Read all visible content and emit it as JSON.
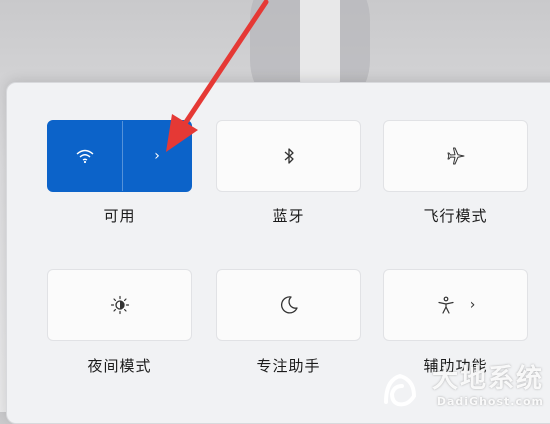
{
  "quick_settings": {
    "tiles": [
      {
        "id": "wifi",
        "label": "可用",
        "icon": "wifi-icon",
        "active": true,
        "has_chevron": true
      },
      {
        "id": "bluetooth",
        "label": "蓝牙",
        "icon": "bluetooth-icon",
        "active": false,
        "has_chevron": false
      },
      {
        "id": "airplane",
        "label": "飞行模式",
        "icon": "airplane-icon",
        "active": false,
        "has_chevron": false
      },
      {
        "id": "night-light",
        "label": "夜间模式",
        "icon": "night-light-icon",
        "active": false,
        "has_chevron": false
      },
      {
        "id": "focus-assist",
        "label": "专注助手",
        "icon": "moon-icon",
        "active": false,
        "has_chevron": false
      },
      {
        "id": "accessibility",
        "label": "辅助功能",
        "icon": "accessibility-icon",
        "active": false,
        "has_chevron": true
      }
    ],
    "chevron_glyph": "›",
    "accent_color": "#0c63c9",
    "annotation_arrow_color": "#e53935"
  },
  "watermark": {
    "cn": "大地系统",
    "en": "DadiGhost.com"
  }
}
